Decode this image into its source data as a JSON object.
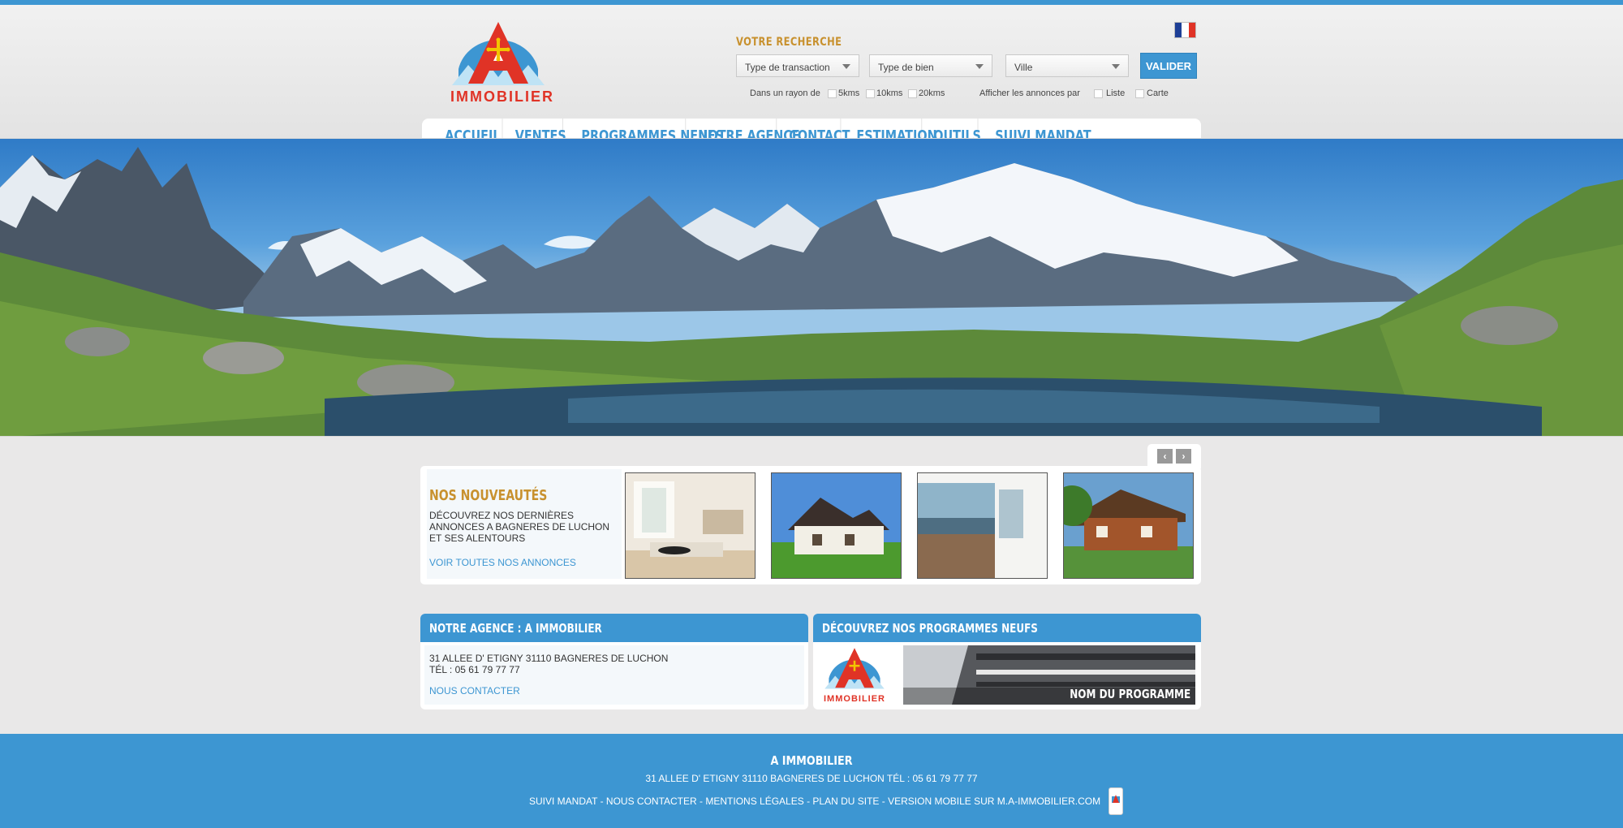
{
  "brand": {
    "logo_text": "IMMOBILIER",
    "accent": "#3d96d2",
    "gold": "#c8912e",
    "red": "#e03326"
  },
  "header": {
    "language_flag": "french-flag-icon"
  },
  "search": {
    "title": "VOTRE RECHERCHE",
    "transaction": "Type de transaction",
    "property_type": "Type de bien",
    "city": "Ville",
    "submit": "VALIDER",
    "radius_label": "Dans un rayon de",
    "radius_options": [
      "5kms",
      "10kms",
      "20kms"
    ],
    "display_label": "Afficher les annonces par",
    "display_options": [
      "Liste",
      "Carte"
    ]
  },
  "nav": {
    "items": [
      "ACCUEIL",
      "VENTES",
      "PROGRAMMES NEUFS",
      "NOTRE AGENCE",
      "CONTACT",
      "ESTIMATION",
      "OUTILS",
      "SUIVI MANDAT"
    ]
  },
  "news": {
    "title": "NOS NOUVEAUTÉS",
    "description": "DÉCOUVREZ NOS DERNIÈRES ANNONCES A BAGNERES DE LUCHON ET SES ALENTOURS",
    "link": "VOIR TOUTES NOS ANNONCES",
    "prev_icon": "chevron-left-icon",
    "next_icon": "chevron-right-icon"
  },
  "agence": {
    "title": "NOTRE AGENCE : A IMMOBILIER",
    "address": "31 ALLEE D' ETIGNY 31110 BAGNERES DE LUCHON",
    "phone": "TÉL : 05 61 79 77 77",
    "link": "NOUS CONTACTER"
  },
  "programmes": {
    "title": "DÉCOUVREZ NOS PROGRAMMES NEUFS",
    "logo_text": "IMMOBILIER",
    "program_name": "NOM DU PROGRAMME"
  },
  "footer": {
    "title": "A IMMOBILIER",
    "address": "31 ALLEE D' ETIGNY 31110 BAGNERES DE LUCHON TÉL : 05 61 79 77 77",
    "links": [
      "SUIVI MANDAT",
      "NOUS CONTACTER",
      "MENTIONS LÉGALES",
      "PLAN DU SITE",
      "VERSION MOBILE SUR M.A-IMMOBILIER.COM"
    ],
    "separator": " - "
  }
}
